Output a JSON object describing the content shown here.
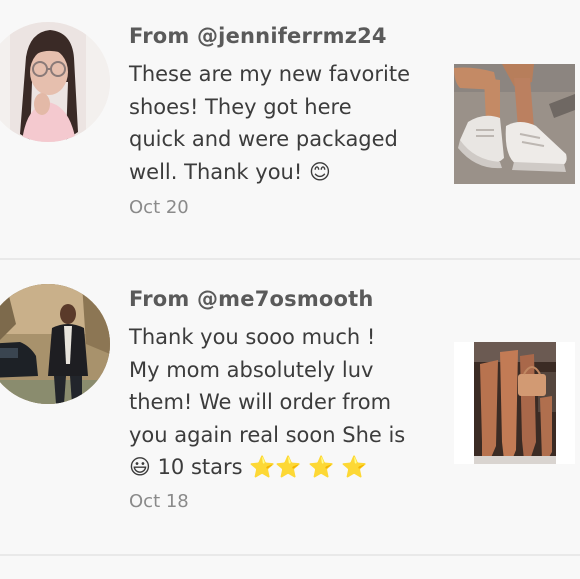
{
  "reviews": [
    {
      "from": "From @jenniferrmz24",
      "text": "These are my new favorite\nshoes! They got here\nquick and were packaged\nwell. Thank you! 😊",
      "date": "Oct 20",
      "avatar_icon": "user-photo",
      "photo_icon": "sneakers-photo"
    },
    {
      "from": "From @me7osmooth",
      "text": "Thank you sooo much !\nMy mom absolutely luv\nthem! We will order from\nyou again real soon She is\n😃 10 stars ⭐⭐ ⭐ ⭐",
      "date": "Oct 18",
      "avatar_icon": "user-photo",
      "photo_icon": "boots-photo"
    }
  ],
  "colors": {
    "background": "#f8f8f8",
    "divider": "#e9e9e9",
    "username": "#5a5a5a",
    "body_text": "#3c3c3c",
    "date": "#8a8a8a"
  }
}
